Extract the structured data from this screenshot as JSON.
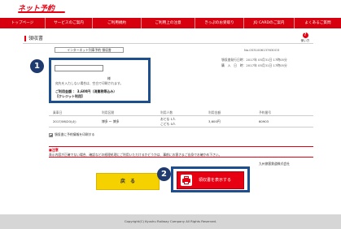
{
  "header": {
    "logo_text": "ネット予約"
  },
  "nav": {
    "items": [
      {
        "label": "トップページ"
      },
      {
        "label": "サービスのご案内"
      },
      {
        "label": "ご利用規約"
      },
      {
        "label": "ご利用上の注意"
      },
      {
        "label": "きっぷのお受取り"
      },
      {
        "label": "JQ CARDのご案内"
      },
      {
        "label": "よくあるご質問"
      }
    ]
  },
  "page": {
    "title": "領収書",
    "help_label": "使い方"
  },
  "receipt": {
    "type_label": "インターネット列車予約 領収書",
    "receipt_no": "No.0531006137630O3",
    "issue_datetime": "領収書発行日時：2017年 05月31日 17時05分",
    "purchase_datetime": "購　入　日　時：2017年 05月31日 17時05分",
    "name_value": "",
    "name_suffix": "様",
    "name_hint": "宛先を入力しない場合は、空白で印刷されます。",
    "amount": "ご利用金額 ： 3,600円（消費税等込み）",
    "payment_method": "【クレジット利用】"
  },
  "table": {
    "headers": [
      "乗車日",
      "利用区間",
      "利用人数",
      "利用金額",
      "予約番号"
    ],
    "rows": [
      {
        "date": "2017/06/20(火)",
        "section": "博多 ～ 博多",
        "persons_adult": "おとな 1人",
        "persons_child": "こども 0人",
        "amount": "3,600円",
        "reservation": "60903"
      }
    ]
  },
  "print_option": {
    "label": "領収書に予約情報を印刷する"
  },
  "notice": {
    "title": "■注意",
    "text": "表示内容が正確でない場合、確認などの経理処理にご利用いただけるかどうかは、事前にお客さまご自身でお確かめ下さい。"
  },
  "company": "九州旅客鉄道株式会社",
  "buttons": {
    "back": "戻　る",
    "show_receipt": "領収書を表示する"
  },
  "annotations": {
    "badge1": "1",
    "badge2": "2"
  },
  "footer": {
    "copyright": "Copyright(C) Kyushu Railway Company All Rights Reserved."
  },
  "colors": {
    "brand_red": "#e60012",
    "annotation_blue": "#1d4f8f",
    "back_yellow": "#f5d100"
  }
}
